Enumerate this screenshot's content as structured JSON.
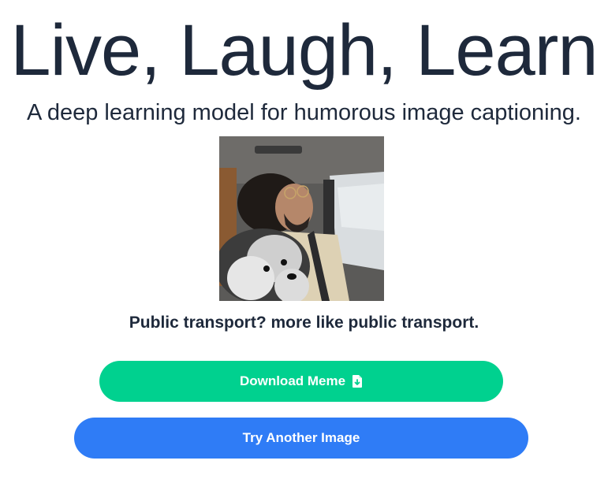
{
  "header": {
    "title": "Live, Laugh, Learn",
    "subtitle": "A deep learning model for humorous image captioning."
  },
  "image": {
    "description_icon": "photo-of-man-sleeping-in-car-with-dog"
  },
  "caption": "Public transport? more like public transport.",
  "buttons": {
    "download_label": "Download Meme",
    "download_icon": "file-download-icon",
    "another_label": "Try Another Image"
  },
  "colors": {
    "download_bg": "#00d18f",
    "another_bg": "#2f7cf6",
    "text": "#1e293b"
  }
}
